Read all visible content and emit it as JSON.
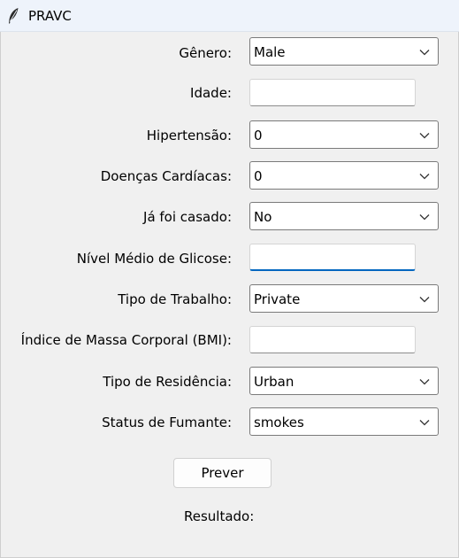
{
  "window": {
    "title": "PRAVC",
    "icon": "feather-icon"
  },
  "form": {
    "genero": {
      "label": "Gênero:",
      "value": "Male",
      "icon": "chevron-down-icon"
    },
    "idade": {
      "label": "Idade:",
      "value": ""
    },
    "hipertensao": {
      "label": "Hipertensão:",
      "value": "0",
      "icon": "chevron-down-icon"
    },
    "doencas": {
      "label": "Doenças Cardíacas:",
      "value": "0",
      "icon": "chevron-down-icon"
    },
    "casado": {
      "label": "Já foi casado:",
      "value": "No",
      "icon": "chevron-down-icon"
    },
    "glicose": {
      "label": "Nível Médio de Glicose:",
      "value": ""
    },
    "trabalho": {
      "label": "Tipo de Trabalho:",
      "value": "Private",
      "icon": "chevron-down-icon"
    },
    "bmi": {
      "label": "Índice de Massa Corporal (BMI):",
      "value": ""
    },
    "residencia": {
      "label": "Tipo de Residência:",
      "value": "Urban",
      "icon": "chevron-down-icon"
    },
    "fumante": {
      "label": "Status de Fumante:",
      "value": "smokes",
      "icon": "chevron-down-icon"
    }
  },
  "predict_button": {
    "label": "Prever"
  },
  "result": {
    "label": "Resultado:"
  },
  "colors": {
    "focus_accent": "#0067c0",
    "titlebar": "#eef3fb",
    "window_bg": "#f0f0f0"
  }
}
